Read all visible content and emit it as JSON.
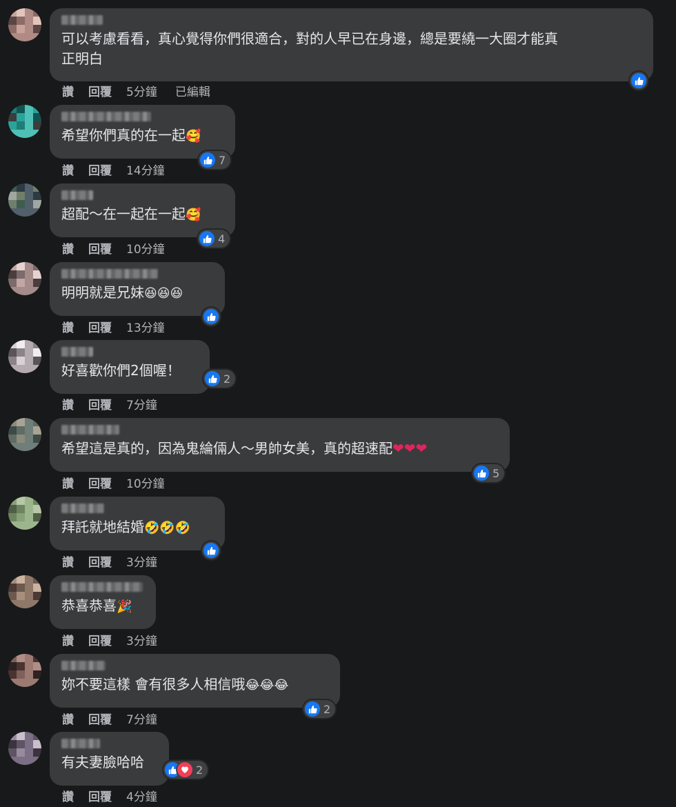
{
  "actions": {
    "like": "讚",
    "reply": "回覆",
    "edited": "已編輯"
  },
  "colors": {
    "like_blue": "#1877f2",
    "love_red": "#f33e58",
    "bubble": "#3a3b3c",
    "background": "#18191a"
  },
  "comments": [
    {
      "text": "可以考慮看看，真心覺得你們很適合，對的人早已在身邊，總是要繞一大圈才能真\n正明白",
      "time": "5分鐘",
      "edited": true,
      "reactions": [
        "like"
      ],
      "count": ""
    },
    {
      "text": "希望你們真的在一起",
      "emoji": "🥰",
      "time": "14分鐘",
      "reactions": [
        "like"
      ],
      "count": "7"
    },
    {
      "text": "超配～在一起在一起",
      "emoji": "🥰",
      "time": "10分鐘",
      "reactions": [
        "like"
      ],
      "count": "4"
    },
    {
      "text": "明明就是兄妹",
      "emoji": "😆😆😆",
      "time": "13分鐘",
      "reactions": [
        "like"
      ],
      "count": ""
    },
    {
      "text": "好喜歡你們2個喔！",
      "emoji": "",
      "time": "7分鐘",
      "reactions": [
        "like"
      ],
      "count": "2"
    },
    {
      "text": "希望這是真的，因為鬼綸倆人～男帥女美，真的超速配",
      "emoji": "❤❤❤",
      "time": "10分鐘",
      "reactions": [
        "like"
      ],
      "count": "5"
    },
    {
      "text": "拜託就地結婚",
      "emoji": "🤣🤣🤣",
      "time": "3分鐘",
      "reactions": [
        "like"
      ],
      "count": ""
    },
    {
      "text": "恭喜恭喜",
      "emoji": "🎉",
      "time": "3分鐘",
      "reactions": [],
      "count": ""
    },
    {
      "text": "妳不要這樣 會有很多人相信哦",
      "emoji": "😂😂😂",
      "time": "7分鐘",
      "reactions": [
        "like"
      ],
      "count": "2"
    },
    {
      "text": "有夫妻臉哈哈",
      "emoji": "",
      "time": "4分鐘",
      "reactions": [
        "like",
        "love"
      ],
      "count": "2"
    }
  ]
}
